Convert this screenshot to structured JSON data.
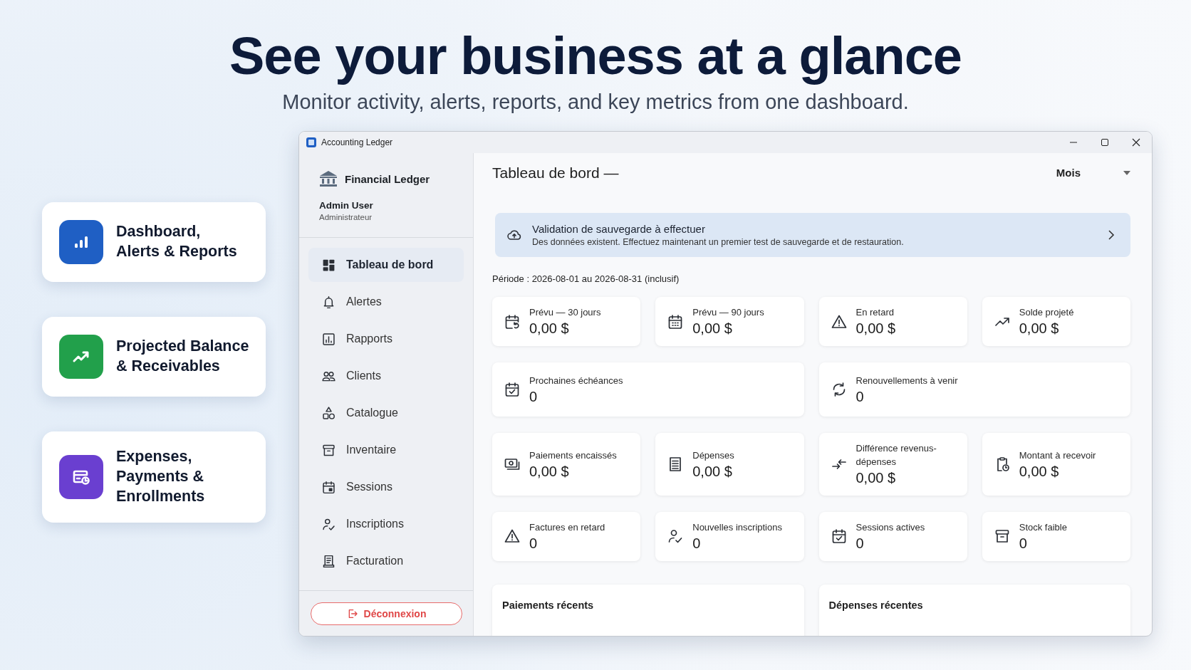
{
  "hero": {
    "title": "See your business at a glance",
    "subtitle": "Monitor activity, alerts, reports, and key metrics from one dashboard."
  },
  "features": [
    {
      "label": "Dashboard,\nAlerts & Reports",
      "color": "#1f5fc4"
    },
    {
      "label": "Projected Balance\n& Receivables",
      "color": "#22a04b"
    },
    {
      "label": "Expenses,\nPayments &\nEnrollments",
      "color": "#6a3fd0"
    }
  ],
  "window": {
    "title": "Accounting Ledger"
  },
  "sidebar": {
    "brand": "Financial Ledger",
    "user": "Admin User",
    "role": "Administrateur",
    "items": [
      {
        "label": "Tableau de bord",
        "selected": true
      },
      {
        "label": "Alertes",
        "selected": false
      },
      {
        "label": "Rapports",
        "selected": false
      },
      {
        "label": "Clients",
        "selected": false
      },
      {
        "label": "Catalogue",
        "selected": false
      },
      {
        "label": "Inventaire",
        "selected": false
      },
      {
        "label": "Sessions",
        "selected": false
      },
      {
        "label": "Inscriptions",
        "selected": false
      },
      {
        "label": "Facturation",
        "selected": false
      }
    ],
    "logout": "Déconnexion"
  },
  "main": {
    "title": "Tableau de bord —",
    "period_select": "Mois",
    "banner": {
      "title": "Validation de sauvegarde à effectuer",
      "text": "Des données existent. Effectuez maintenant un premier test de sauvegarde et de restauration."
    },
    "period": "Période : 2026-08-01 au 2026-08-31 (inclusif)",
    "stats": [
      {
        "label": "Prévu — 30 jours",
        "value": "0,00 $",
        "wide": false
      },
      {
        "label": "Prévu — 90 jours",
        "value": "0,00 $",
        "wide": false
      },
      {
        "label": "En retard",
        "value": "0,00 $",
        "wide": false
      },
      {
        "label": "Solde projeté",
        "value": "0,00 $",
        "wide": false
      },
      {
        "label": "Prochaines échéances",
        "value": "0",
        "wide": true
      },
      {
        "label": "Renouvellements à venir",
        "value": "0",
        "wide": true
      },
      {
        "label": "Paiements encaissés",
        "value": "0,00 $",
        "wide": false
      },
      {
        "label": "Dépenses",
        "value": "0,00 $",
        "wide": false
      },
      {
        "label": "Différence revenus-dépenses",
        "value": "0,00 $",
        "wide": false
      },
      {
        "label": "Montant à recevoir",
        "value": "0,00 $",
        "wide": false
      },
      {
        "label": "Factures en retard",
        "value": "0",
        "wide": false
      },
      {
        "label": "Nouvelles inscriptions",
        "value": "0",
        "wide": false
      },
      {
        "label": "Sessions actives",
        "value": "0",
        "wide": false
      },
      {
        "label": "Stock faible",
        "value": "0",
        "wide": false
      }
    ],
    "recent": [
      "Paiements récents",
      "Dépenses récentes"
    ]
  }
}
